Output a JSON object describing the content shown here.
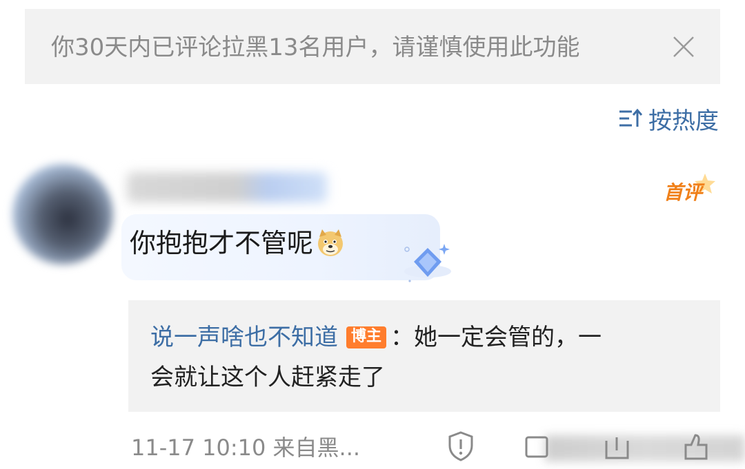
{
  "notice": {
    "text": "你30天内已评论拉黑13名用户，请谨慎使用此功能",
    "close_icon": "close-icon"
  },
  "sort": {
    "label": "按热度",
    "icon": "sort-icon"
  },
  "comment": {
    "first_badge": "首评",
    "text": "你抱抱才不管呢",
    "emoji": "doge-emoji",
    "reply": {
      "author": "说一声啥也不知道",
      "role_badge": "博主",
      "colon": "：",
      "text_line1": "她一定会管的，一",
      "text_line2": "会就让这个人赶紧走了"
    },
    "meta": "11-17 10:10 来自黑..."
  },
  "colors": {
    "link_blue": "#3d6ea5",
    "accent_orange": "#f08019",
    "badge_orange": "#ff7d2d",
    "gray_text": "#8a8a8a"
  }
}
